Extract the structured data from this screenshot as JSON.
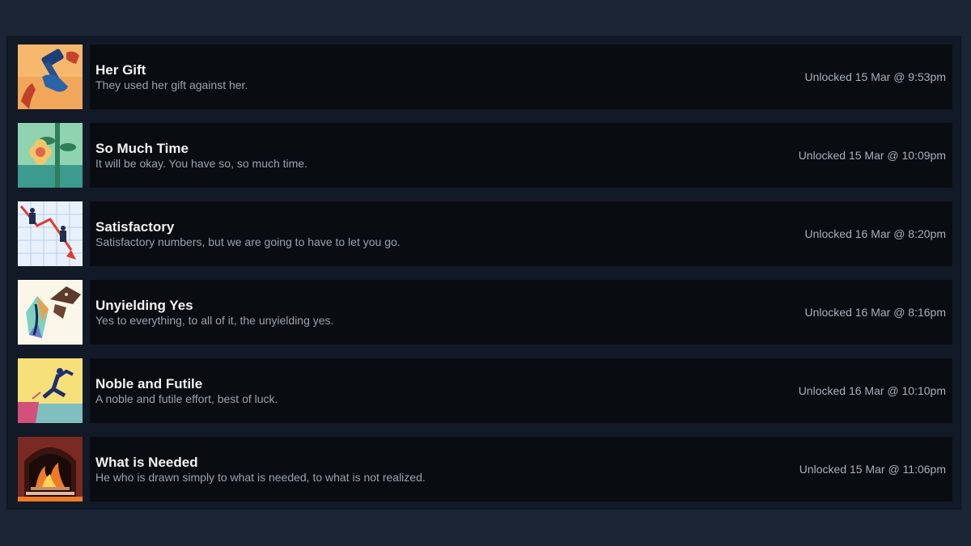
{
  "achievements": [
    {
      "title": "Her Gift",
      "description": "They used her gift against her.",
      "unlocked": "Unlocked 15 Mar @ 9:53pm",
      "icon": "hammer-hands-icon"
    },
    {
      "title": "So Much Time",
      "description": "It will be okay. You have so, so much time.",
      "unlocked": "Unlocked 15 Mar @ 10:09pm",
      "icon": "flower-icon"
    },
    {
      "title": "Satisfactory",
      "description": "Satisfactory numbers, but we are going to have to let you go.",
      "unlocked": "Unlocked 16 Mar @ 8:20pm",
      "icon": "falling-chart-icon"
    },
    {
      "title": "Unyielding Yes",
      "description": "Yes to everything, to all of it, the unyielding yes.",
      "unlocked": "Unlocked 16 Mar @ 8:16pm",
      "icon": "moth-crystal-icon"
    },
    {
      "title": "Noble and Futile",
      "description": "A noble and futile effort, best of luck.",
      "unlocked": "Unlocked 16 Mar @ 10:10pm",
      "icon": "leaping-figure-icon"
    },
    {
      "title": "What is Needed",
      "description": "He who is drawn simply to what is needed, to what is not realized.",
      "unlocked": "Unlocked 15 Mar @ 11:06pm",
      "icon": "fireplace-icon"
    }
  ],
  "colors": {
    "page_background": "#1b2536",
    "panel_background": "#121a27",
    "card_background": "#090c11",
    "title_text": "#f2f2f2",
    "description_text": "#9aa3ad",
    "unlock_text": "#a8b0ba"
  }
}
